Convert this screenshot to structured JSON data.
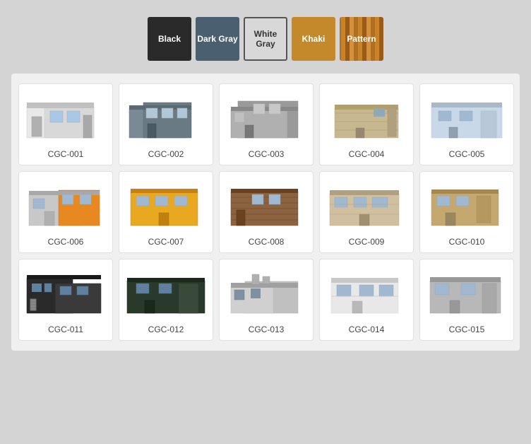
{
  "colors": [
    {
      "id": "black",
      "label": "Black",
      "bg": "#2a2a2a",
      "textClass": ""
    },
    {
      "id": "dark-gray",
      "label": "Dark Gray",
      "bg": "#4a6070",
      "textClass": ""
    },
    {
      "id": "white-gray",
      "label": "White Gray",
      "bg": "#d8d8d8",
      "textClass": "dark-text"
    },
    {
      "id": "khaki",
      "label": "Khaki",
      "bg": "#c4892a",
      "textClass": ""
    },
    {
      "id": "pattern",
      "label": "Pattern",
      "bg": "#b07030",
      "textClass": ""
    }
  ],
  "products": [
    {
      "id": "CGC-001",
      "label": "CGC-001",
      "theme": "white"
    },
    {
      "id": "CGC-002",
      "label": "CGC-002",
      "theme": "gray"
    },
    {
      "id": "CGC-003",
      "label": "CGC-003",
      "theme": "gray2"
    },
    {
      "id": "CGC-004",
      "label": "CGC-004",
      "theme": "tan"
    },
    {
      "id": "CGC-005",
      "label": "CGC-005",
      "theme": "lightblue"
    },
    {
      "id": "CGC-006",
      "label": "CGC-006",
      "theme": "orange-gray"
    },
    {
      "id": "CGC-007",
      "label": "CGC-007",
      "theme": "yellow"
    },
    {
      "id": "CGC-008",
      "label": "CGC-008",
      "theme": "wood"
    },
    {
      "id": "CGC-009",
      "label": "CGC-009",
      "theme": "beige"
    },
    {
      "id": "CGC-010",
      "label": "CGC-010",
      "theme": "tan2"
    },
    {
      "id": "CGC-011",
      "label": "CGC-011",
      "theme": "dark"
    },
    {
      "id": "CGC-012",
      "label": "CGC-012",
      "theme": "darkgreen"
    },
    {
      "id": "CGC-013",
      "label": "CGC-013",
      "theme": "gray3"
    },
    {
      "id": "CGC-014",
      "label": "CGC-014",
      "theme": "white2"
    },
    {
      "id": "CGC-015",
      "label": "CGC-015",
      "theme": "silver"
    }
  ]
}
